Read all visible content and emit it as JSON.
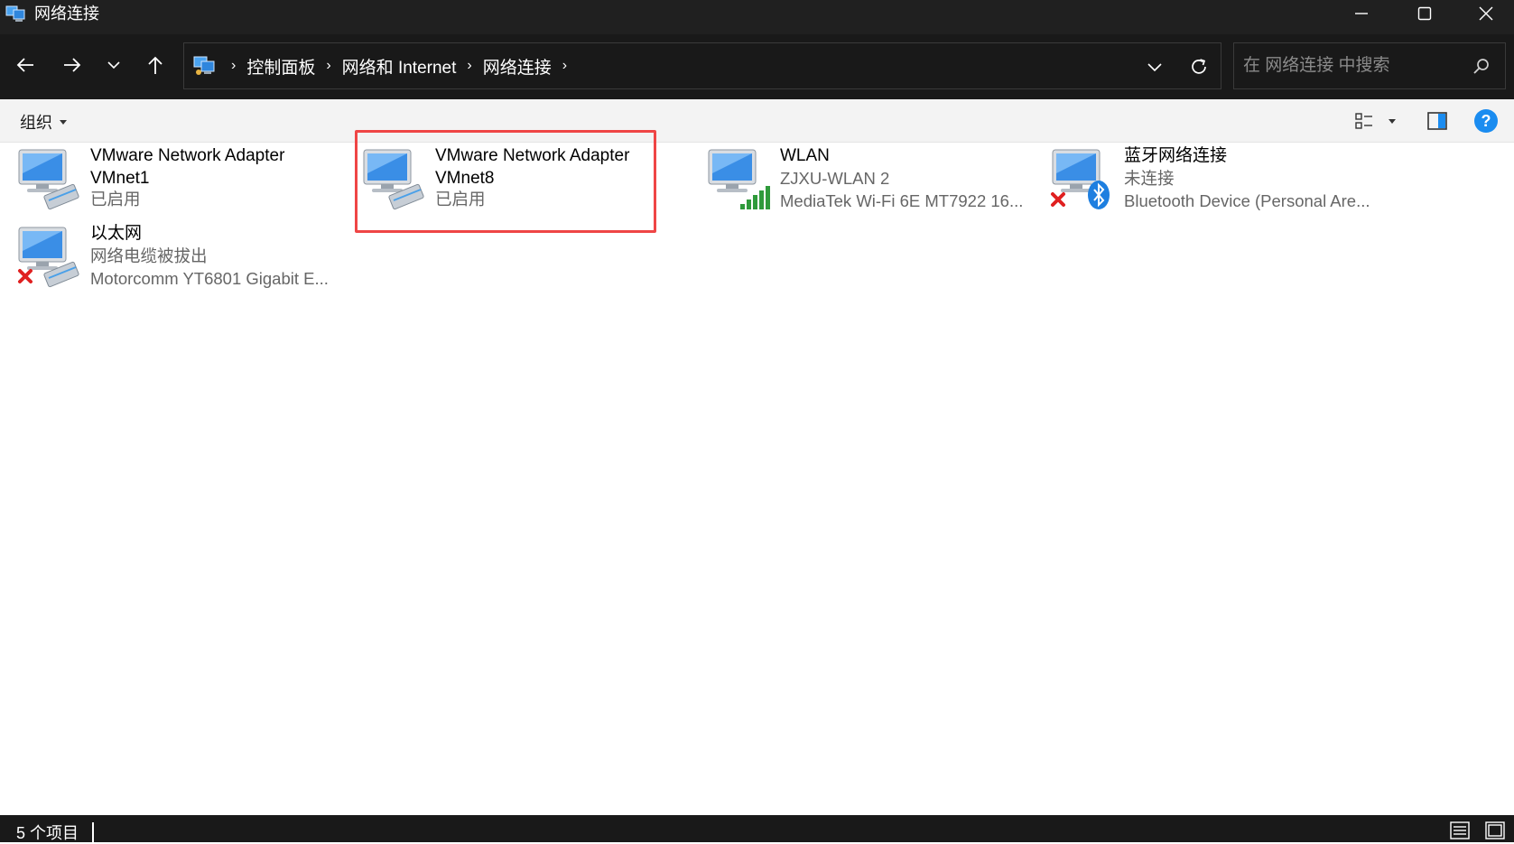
{
  "window": {
    "title": "网络连接"
  },
  "nav": {
    "breadcrumbs": [
      "控制面板",
      "网络和 Internet",
      "网络连接"
    ],
    "search_placeholder": "在 网络连接 中搜索"
  },
  "command_bar": {
    "organize_label": "组织",
    "help_label": "?"
  },
  "connections": [
    {
      "name": "VMware Network Adapter VMnet1",
      "status": "已启用",
      "device": "",
      "icon": "network-adapter-icon"
    },
    {
      "name": "VMware Network Adapter VMnet8",
      "status": "已启用",
      "device": "",
      "icon": "network-adapter-icon",
      "selected": true
    },
    {
      "name": "WLAN",
      "status": "ZJXU-WLAN 2",
      "device": "MediaTek Wi-Fi 6E MT7922 16...",
      "icon": "wifi-adapter-icon"
    },
    {
      "name": "蓝牙网络连接",
      "status": "未连接",
      "device": "Bluetooth Device (Personal Are...",
      "icon": "bluetooth-adapter-icon",
      "disconnected": true
    },
    {
      "name": "以太网",
      "status": "网络电缆被拔出",
      "device": "Motorcomm YT6801 Gigabit E...",
      "icon": "ethernet-adapter-icon",
      "disconnected": true
    }
  ],
  "status_bar": {
    "item_count": "5 个项目"
  },
  "colors": {
    "selection_outline": "#ef4545",
    "titlebar_bg": "#202020",
    "help_blue": "#1a8cf0"
  }
}
